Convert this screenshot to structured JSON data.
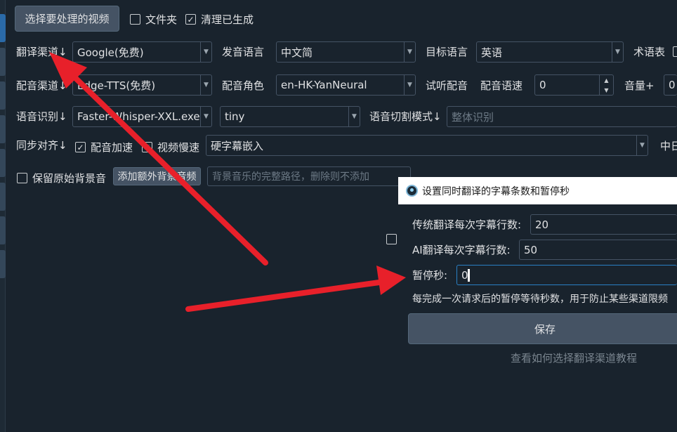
{
  "toolbar": {
    "select_video": "选择要处理的视频",
    "folder": "文件夹",
    "clear_generated": "清理已生成"
  },
  "row_translate": {
    "channel_label": "翻译渠道↓",
    "channel_value": "Google(免费)",
    "source_lang_label": "发音语言",
    "source_lang_value": "中文简",
    "target_lang_label": "目标语言",
    "target_lang_value": "英语",
    "glossary_label": "术语表"
  },
  "row_dubbing": {
    "channel_label": "配音渠道↓",
    "channel_value": "Edge-TTS(免费)",
    "role_label": "配音角色",
    "role_value": "en-HK-YanNeural",
    "preview_label": "试听配音",
    "speed_label": "配音语速",
    "speed_value": "0",
    "volume_label": "音量+",
    "volume_value": "0"
  },
  "row_asr": {
    "label": "语音识别↓",
    "engine_value": "Faster-Whisper-XXL.exe",
    "model_value": "tiny",
    "split_label": "语音切割模式↓",
    "split_placeholder": "整体识别"
  },
  "row_sync": {
    "label": "同步对齐↓",
    "dub_speedup": "配音加速",
    "video_slow": "视频慢速",
    "subtitle_mode": "硬字幕嵌入",
    "right_partial": "中日"
  },
  "row_bgm": {
    "keep_original": "保留原始背景音",
    "add_bgm_button": "添加额外背景音频",
    "bgm_path_placeholder": "背景音乐的完整路径，删除则不添加"
  },
  "dialog": {
    "title": "设置同时翻译的字幕条数和暂停秒",
    "trad_label": "传统翻译每次字幕行数:",
    "trad_value": "20",
    "ai_label": "AI翻译每次字幕行数:",
    "ai_value": "50",
    "pause_label": "暂停秒:",
    "pause_value": "0",
    "tip": "每完成一次请求后的暂停等待秒数，用于防止某些渠道限频",
    "save": "保存",
    "help_link": "查看如何选择翻译渠道教程"
  },
  "colors": {
    "background": "#19232d",
    "button": "#455364",
    "annotation_arrow": "#e8202a"
  }
}
